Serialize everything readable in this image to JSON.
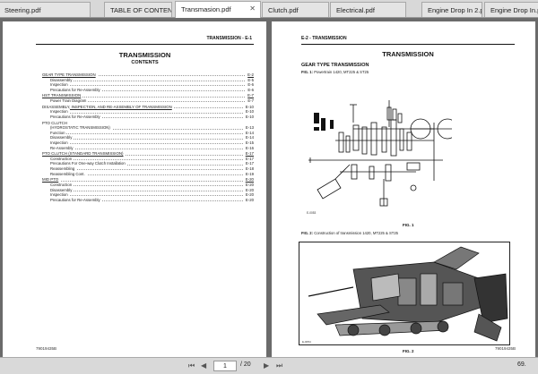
{
  "tabs": [
    {
      "label": "Steering.pdf",
      "active": false
    },
    {
      "label": "TABLE OF CONTENT...",
      "active": false
    },
    {
      "label": "Transmasion.pdf",
      "active": true
    },
    {
      "label": "Clutch.pdf",
      "active": false
    },
    {
      "label": "Electrical.pdf",
      "active": false
    },
    {
      "label": "Engine Drop In 2.pdf",
      "active": false
    },
    {
      "label": "Engine Drop In.pdf",
      "active": false
    }
  ],
  "left_page": {
    "header": "TRANSMISSION - E-1",
    "title": "TRANSMISSION",
    "subtitle": "CONTENTS",
    "toc": [
      {
        "label": "GEAR TYPE TRANSMISSION",
        "page": "E-2",
        "level": 0
      },
      {
        "label": "Disassembly",
        "page": "E-5",
        "level": 1
      },
      {
        "label": "Inspection",
        "page": "E-6",
        "level": 1
      },
      {
        "label": "Precautions for Re-Assembly",
        "page": "E-6",
        "level": 1
      },
      {
        "label": "HST TRANSMISSION",
        "page": "E-7",
        "level": 0
      },
      {
        "label": "Power Train Diagram",
        "page": "E-7",
        "level": 1
      },
      {
        "label": "DISASSEMBLY, INSPECTION, AND RE-ASSEMBLY OF TRANSMISSION",
        "page": "E-10",
        "level": 0
      },
      {
        "label": "Inspection",
        "page": "E-10",
        "level": 1
      },
      {
        "label": "Precautions for Re-Assembly",
        "page": "E-10",
        "level": 1
      },
      {
        "label": "PTO CLUTCH",
        "page": "",
        "level": 0
      },
      {
        "label": "(HYDROSTATIC TRANSMISSION)",
        "page": "E-13",
        "level": 1
      },
      {
        "label": "Function",
        "page": "E-14",
        "level": 1
      },
      {
        "label": "Disassembly",
        "page": "E-14",
        "level": 1
      },
      {
        "label": "Inspection",
        "page": "E-15",
        "level": 1
      },
      {
        "label": "Re-Assembly",
        "page": "E-16",
        "level": 1
      },
      {
        "label": "PTO CLUTCH (STANDARD TRANSMISSION)",
        "page": "E-17",
        "level": 0
      },
      {
        "label": "Construction",
        "page": "E-17",
        "level": 1
      },
      {
        "label": "Precautions For One-way Clutch Installation",
        "page": "E-17",
        "level": 1
      },
      {
        "label": "Reassembling",
        "page": "E-18",
        "level": 1
      },
      {
        "label": "Reassembling Cont.",
        "page": "E-19",
        "level": 1
      },
      {
        "label": "MID PTO",
        "page": "E-20",
        "level": 0
      },
      {
        "label": "Construction",
        "page": "E-20",
        "level": 1
      },
      {
        "label": "Disassembly",
        "page": "E-20",
        "level": 1
      },
      {
        "label": "Inspection",
        "page": "E-20",
        "level": 1
      },
      {
        "label": "Precautions for Re-Assembly",
        "page": "E-20",
        "level": 1
      }
    ],
    "footer": "79019435B"
  },
  "right_page": {
    "header": "E-2 - TRANSMISSION",
    "title": "TRANSMISSION",
    "section": "GEAR TYPE TRANSMISSION",
    "fig1_caption_num": "FIG. 1:",
    "fig1_caption": "Powertrain 1420, MT225 & ST25",
    "fig1_label": "FIG. 1",
    "fig2_caption_num": "FIG. 2:",
    "fig2_caption": "Construction of transmission 1420, MT225 & ST25",
    "fig2_label": "FIG. 2",
    "footer": "79019435B"
  },
  "status": {
    "page_input": "1",
    "page_total": "/ 20",
    "zoom": "69."
  }
}
